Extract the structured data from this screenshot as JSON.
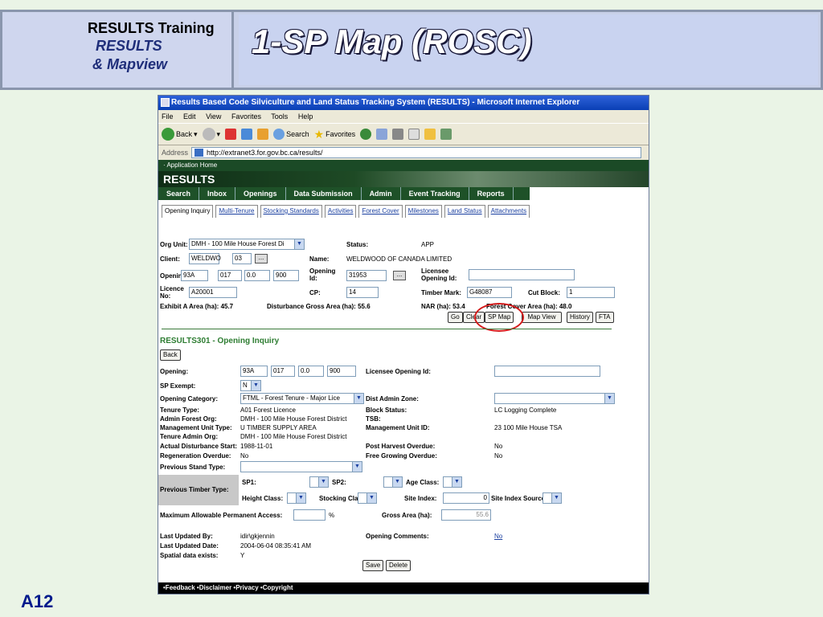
{
  "slide": {
    "header_l1": "RESULTS Training",
    "header_l2": "RESULTS",
    "header_l3": "& Mapview",
    "title": "1-SP Map (ROSC)",
    "slide_id": "A12"
  },
  "browser": {
    "title": "Results Based Code Silviculture and Land Status Tracking System (RESULTS) - Microsoft Internet Explorer",
    "menu": [
      "File",
      "Edit",
      "View",
      "Favorites",
      "Tools",
      "Help"
    ],
    "back": "Back",
    "search": "Search",
    "favorites": "Favorites",
    "address_label": "Address",
    "address": "http://extranet3.for.gov.bc.ca/results/"
  },
  "app": {
    "home_link": "· Application Home",
    "brand": "RESULTS",
    "nav": [
      "Search",
      "Inbox",
      "Openings",
      "Data Submission",
      "Admin",
      "Event Tracking",
      "Reports"
    ],
    "subtabs": [
      "Opening Inquiry",
      "Multi-Tenure",
      "Stocking Standards",
      "Activities",
      "Forest Cover",
      "Milestones",
      "Land Status",
      "Attachments"
    ]
  },
  "inquiry": {
    "org_unit_label": "Org Unit:",
    "org_unit": "DMH - 100 Mile House Forest Di",
    "status_label": "Status:",
    "status": "APP",
    "client_label": "Client:",
    "client": "WELDWO",
    "client_loc": "03",
    "name_label": "Name:",
    "name": "WELDWOOD OF CANADA LIMITED",
    "opening_label": "Opening:",
    "opening": [
      "93A",
      "017",
      "0.0",
      "900"
    ],
    "opening_id_label": "Opening Id:",
    "opening_id": "31953",
    "licensee_opening_label": "Licensee Opening Id:",
    "licensee_opening": "",
    "licence_label": "Licence No:",
    "licence": "A20001",
    "cp_label": "CP:",
    "cp": "14",
    "timber_mark_label": "Timber Mark:",
    "timber_mark": "G48087",
    "cut_block_label": "Cut Block:",
    "cut_block": "1",
    "exhibit_a": "Exhibit A Area (ha): 45.7",
    "disturbance": "Disturbance Gross Area (ha): 55.6",
    "nar": "NAR (ha): 53.4",
    "forest_cover": "Forest Cover Area (ha): 48.0",
    "buttons": [
      "Go",
      "Clear",
      "SP Map",
      "Map View",
      "History",
      "FTA"
    ]
  },
  "detail": {
    "title": "RESULTS301 - Opening Inquiry",
    "back": "Back",
    "opening_label": "Opening:",
    "opening": [
      "93A",
      "017",
      "0.0",
      "900"
    ],
    "licensee_opening_label": "Licensee Opening Id:",
    "sp_exempt_label": "SP Exempt:",
    "sp_exempt": "N",
    "opening_category_label": "Opening Category:",
    "opening_category": "FTML - Forest Tenure - Major Lice",
    "dist_admin_zone_label": "Dist Admin Zone:",
    "tenure_type_label": "Tenure Type:",
    "tenure_type": "A01  Forest Licence",
    "block_status_label": "Block Status:",
    "block_status": "LC  Logging Complete",
    "admin_forest_org_label": "Admin Forest Org:",
    "admin_forest_org": "DMH - 100 Mile House Forest District",
    "tsb_label": "TSB:",
    "mgmt_unit_type_label": "Management Unit Type:",
    "mgmt_unit_type": "U  TIMBER SUPPLY AREA",
    "mgmt_unit_id_label": "Management Unit ID:",
    "mgmt_unit_id": "23  100 Mile House TSA",
    "tenure_admin_org_label": "Tenure Admin Org:",
    "tenure_admin_org": "DMH - 100 Mile House Forest District",
    "actual_dist_start_label": "Actual Disturbance Start:",
    "actual_dist_start": "1988-11-01",
    "post_harvest_label": "Post Harvest Overdue:",
    "post_harvest": "No",
    "regen_overdue_label": "Regeneration Overdue:",
    "regen_overdue": "No",
    "free_growing_label": "Free Growing Overdue:",
    "free_growing": "No",
    "prev_stand_label": "Previous Stand Type:",
    "prev_timber_label": "Previous Timber Type:",
    "sp1_label": "SP1:",
    "sp2_label": "SP2:",
    "age_class_label": "Age Class:",
    "height_class_label": "Height Class:",
    "stocking_class_label": "Stocking Class:",
    "site_index_label": "Site Index:",
    "site_index": "0",
    "site_index_source_label": "Site Index Source:",
    "max_access_label": "Maximum Allowable Permanent Access:",
    "percent": "%",
    "gross_area_label": "Gross Area (ha):",
    "gross_area": "55.6",
    "last_updated_by_label": "Last Updated By:",
    "last_updated_by": "idir\\gkjennin",
    "opening_comments_label": "Opening Comments:",
    "opening_comments": "No",
    "last_updated_date_label": "Last Updated Date:",
    "last_updated_date": "2004-06-04 08:35:41 AM",
    "spatial_label": "Spatial data exists:",
    "spatial": "Y",
    "save": "Save",
    "delete": "Delete"
  },
  "footer": "•Feedback  •Disclaimer  •Privacy  •Copyright"
}
